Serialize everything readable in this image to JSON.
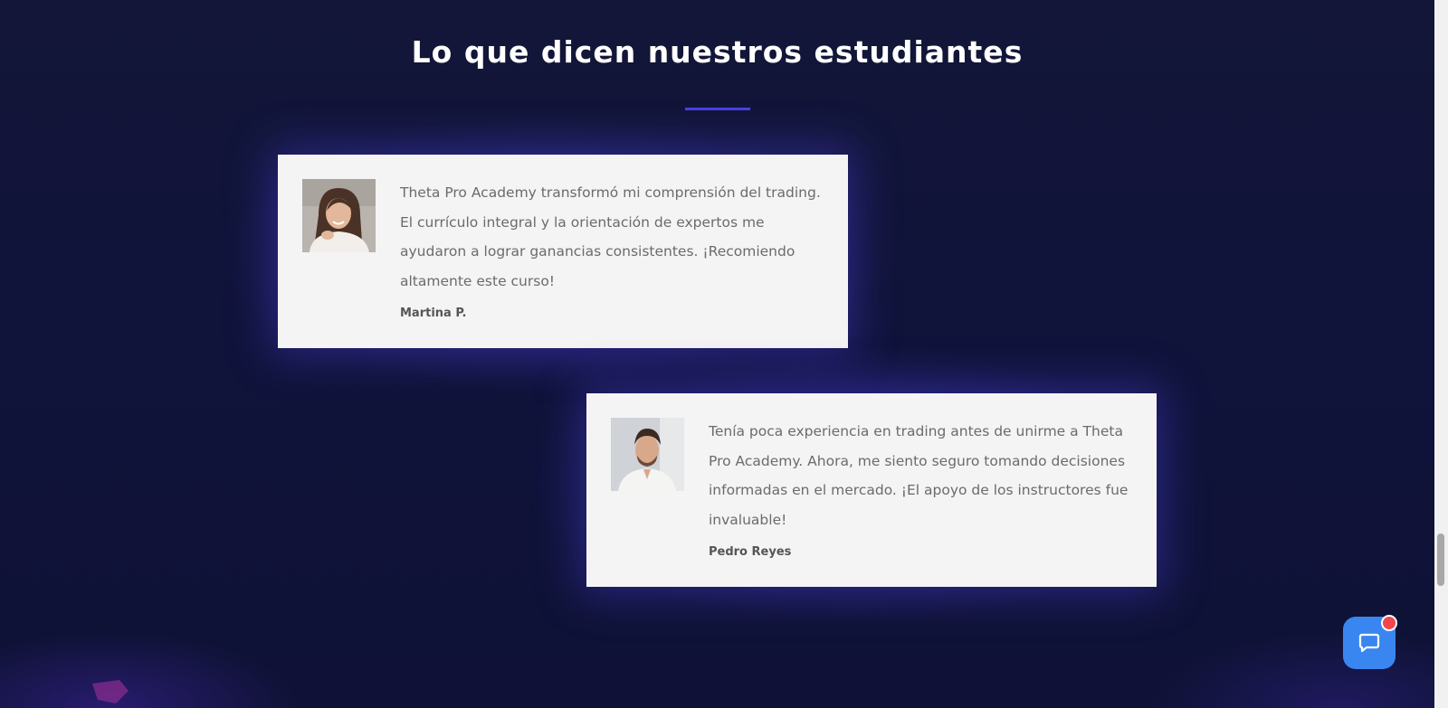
{
  "section": {
    "title": "Lo que dicen nuestros estudiantes",
    "accent_color": "#4a3fe0"
  },
  "testimonials": [
    {
      "quote": "Theta Pro Academy transformó mi comprensión del trading. El currículo integral y la orientación de expertos me ayudaron a lograr ganancias consistentes. ¡Recomiendo altamente este curso!",
      "author": "Martina P.",
      "avatar_icon": "woman-portrait"
    },
    {
      "quote": "Tenía poca experiencia en trading antes de unirme a Theta Pro Academy. Ahora, me siento seguro tomando decisiones informadas en el mercado. ¡El apoyo de los instructores fue invaluable!",
      "author": "Pedro Reyes",
      "avatar_icon": "man-portrait"
    }
  ],
  "chat_widget": {
    "icon": "chat-bubble-icon",
    "color": "#3a86f0",
    "badge_color": "#f0474e"
  },
  "colors": {
    "background": "#12153a",
    "card": "#f4f4f4",
    "text": "#6b6b6b"
  }
}
